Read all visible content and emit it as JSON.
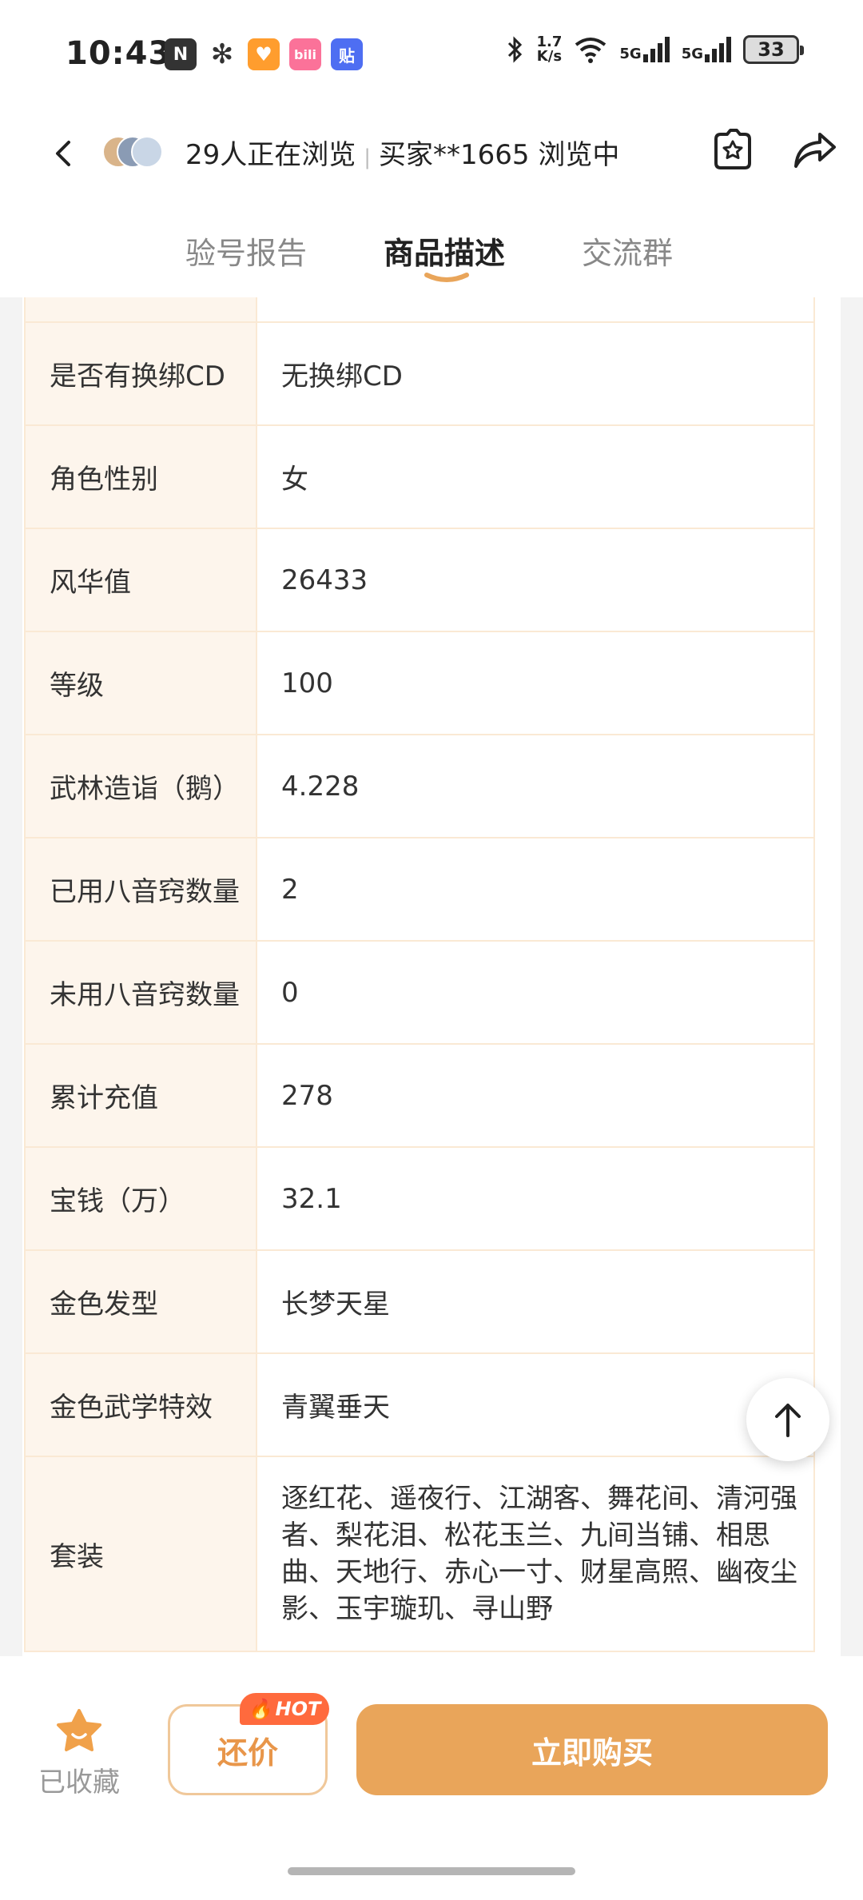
{
  "status_bar": {
    "time": "10:43",
    "net_speed_value": "1.7",
    "net_speed_unit": "K/s",
    "signal_1": "5G",
    "signal_2": "5G",
    "battery": "33"
  },
  "header": {
    "viewers_text": "29人正在浏览",
    "buyer_text": "买家**1665 浏览中"
  },
  "tabs": [
    {
      "label": "验号报告",
      "active": false
    },
    {
      "label": "商品描述",
      "active": true
    },
    {
      "label": "交流群",
      "active": false
    }
  ],
  "spec_rows": [
    {
      "key": "",
      "value": ""
    },
    {
      "key": "是否有换绑CD",
      "value": "无换绑CD"
    },
    {
      "key": "角色性别",
      "value": "女"
    },
    {
      "key": "风华值",
      "value": "26433"
    },
    {
      "key": "等级",
      "value": "100"
    },
    {
      "key": "武林造诣（鹅）",
      "value": "4.228"
    },
    {
      "key": "已用八音窍数量",
      "value": "2"
    },
    {
      "key": "未用八音窍数量",
      "value": "0"
    },
    {
      "key": "累计充值",
      "value": "278"
    },
    {
      "key": "宝钱（万）",
      "value": "32.1"
    },
    {
      "key": "金色发型",
      "value": "长梦天星"
    },
    {
      "key": "金色武学特效",
      "value": "青翼垂天"
    },
    {
      "key": "套装",
      "value": "逐红花、遥夜行、江湖客、舞花间、清河强者、梨花泪、松花玉兰、九间当铺、相思曲、天地行、赤心一寸、财星高照、幽夜尘影、玉宇璇玑、寻山野"
    }
  ],
  "bottom_bar": {
    "collect_label": "已收藏",
    "bargain_label": "还价",
    "hot_badge": "HOT",
    "buy_label": "立即购买"
  },
  "colors": {
    "accent": "#e9a55a",
    "hot": "#ff6a3d",
    "table_border": "#fae9d4",
    "key_bg": "#fdf5ec"
  }
}
